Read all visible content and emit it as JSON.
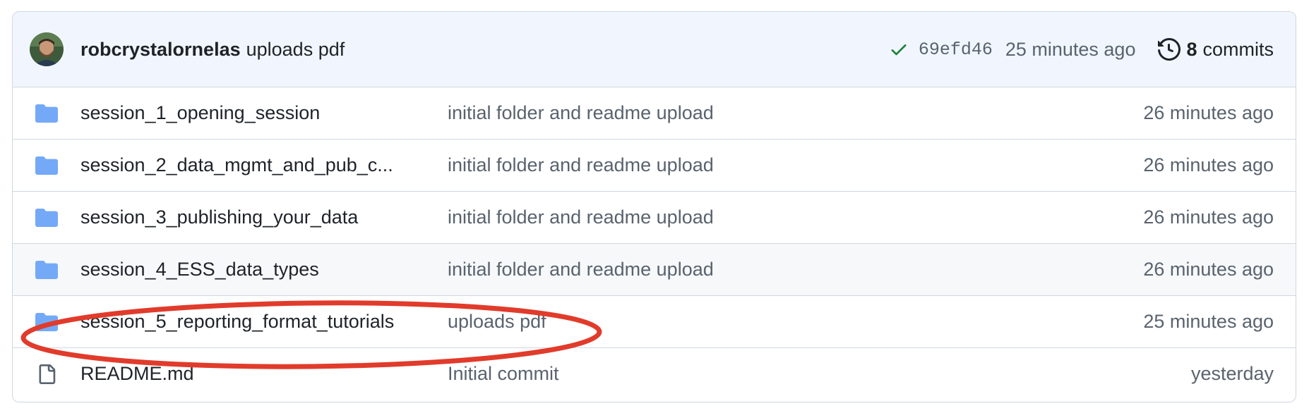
{
  "latest_commit": {
    "author": "robcrystalornelas",
    "message": "uploads pdf",
    "status_icon": "check-icon",
    "status_color": "#1a7f37",
    "sha": "69efd46",
    "time": "25 minutes ago",
    "history_icon": "history-icon",
    "commit_count": "8",
    "commits_label": "commits"
  },
  "colors": {
    "folder": "#74a9f7",
    "file": "#59636e",
    "header_bg": "#f1f6fe",
    "annotation": "#e13b2b"
  },
  "files": [
    {
      "type": "folder",
      "icon": "folder-icon",
      "name": "session_1_opening_session",
      "message": "initial folder and readme upload",
      "time": "26 minutes ago"
    },
    {
      "type": "folder",
      "icon": "folder-icon",
      "name": "session_2_data_mgmt_and_pub_c...",
      "message": "initial folder and readme upload",
      "time": "26 minutes ago"
    },
    {
      "type": "folder",
      "icon": "folder-icon",
      "name": "session_3_publishing_your_data",
      "message": "initial folder and readme upload",
      "time": "26 minutes ago"
    },
    {
      "type": "folder",
      "icon": "folder-icon",
      "name": "session_4_ESS_data_types",
      "message": "initial folder and readme upload",
      "time": "26 minutes ago"
    },
    {
      "type": "folder",
      "icon": "folder-icon",
      "name": "session_5_reporting_format_tutorials",
      "message": "uploads pdf",
      "time": "25 minutes ago"
    },
    {
      "type": "file",
      "icon": "file-icon",
      "name": "README.md",
      "message": "Initial commit",
      "time": "yesterday"
    }
  ]
}
